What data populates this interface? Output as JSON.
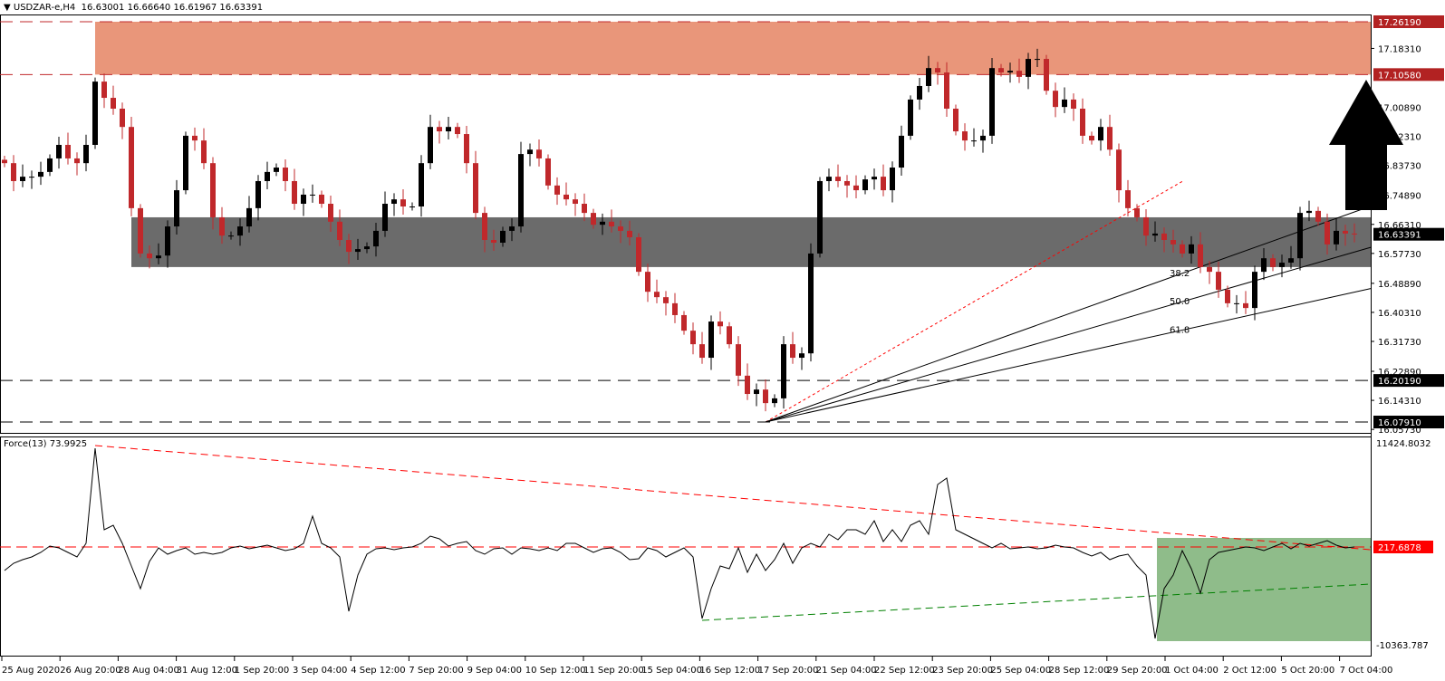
{
  "header": {
    "symbol": "USDZAR-e,H4",
    "open": "16.63001",
    "high": "16.66640",
    "low": "16.61967",
    "close": "16.63391"
  },
  "indicator": {
    "title": "Force(13) 73.9925",
    "level_label": "217.6878",
    "axis_top": "11424.8032",
    "axis_bottom": "-10363.787"
  },
  "colors": {
    "bull": "#000000",
    "bear": "#c0282b",
    "resistance_zone": "#e9967a",
    "support_zone": "#6b6b6b",
    "green_zone": "#8fbc8a",
    "red_line": "#ff0000",
    "green_line": "#008000"
  },
  "chart_data": [
    {
      "type": "candlestick",
      "title": "USDZAR-e,H4",
      "ylim": [
        16.0573,
        17.2619
      ],
      "price_axis_ticks": [
        "17.18310",
        "17.00890",
        "16.92310",
        "16.83730",
        "16.74890",
        "16.66310",
        "16.57730",
        "16.48890",
        "16.40310",
        "16.31730",
        "16.22890",
        "16.14310",
        "16.05730"
      ],
      "price_levels": [
        {
          "label": "17.26190",
          "value": 17.2619,
          "style": "red"
        },
        {
          "label": "17.10580",
          "value": 17.1058,
          "style": "red"
        },
        {
          "label": "16.20190",
          "value": 16.2019,
          "style": "black"
        },
        {
          "label": "16.07910",
          "value": 16.0791,
          "style": "black"
        }
      ],
      "current_price": {
        "label": "16.63391",
        "value": 16.63391
      },
      "resistance_zone": [
        17.1058,
        17.2619
      ],
      "support_zone": [
        16.537,
        16.684
      ],
      "fib_fan": {
        "start_index": 84,
        "start_price": 16.0791,
        "end_index": 130,
        "end_price": 16.79,
        "levels": [
          "38.2",
          "50.0",
          "61.8"
        ]
      },
      "x_labels": [
        "25 Aug 2020",
        "26 Aug 20:00",
        "28 Aug 04:00",
        "31 Aug 12:00",
        "1 Sep 20:00",
        "3 Sep 04:00",
        "4 Sep 12:00",
        "7 Sep 20:00",
        "9 Sep 04:00",
        "10 Sep 12:00",
        "11 Sep 20:00",
        "15 Sep 04:00",
        "16 Sep 12:00",
        "17 Sep 20:00",
        "21 Sep 04:00",
        "22 Sep 12:00",
        "23 Sep 20:00",
        "25 Sep 04:00",
        "28 Sep 12:00",
        "29 Sep 20:00",
        "1 Oct 04:00",
        "2 Oct 12:00",
        "5 Oct 20:00",
        "7 Oct 04:00"
      ],
      "closes": [
        16.844,
        16.791,
        16.804,
        16.804,
        16.818,
        16.858,
        16.898,
        16.858,
        16.844,
        16.898,
        17.085,
        17.037,
        17.005,
        16.951,
        16.711,
        16.577,
        16.563,
        16.571,
        16.657,
        16.764,
        16.925,
        16.911,
        16.844,
        16.684,
        16.63,
        16.63,
        16.657,
        16.711,
        16.791,
        16.818,
        16.831,
        16.791,
        16.724,
        16.751,
        16.751,
        16.724,
        16.671,
        16.617,
        16.582,
        16.59,
        16.598,
        16.644,
        16.724,
        16.737,
        16.716,
        16.716,
        16.844,
        16.951,
        16.938,
        16.951,
        16.93,
        16.844,
        16.697,
        16.617,
        16.609,
        16.644,
        16.657,
        16.871,
        16.884,
        16.858,
        16.778,
        16.751,
        16.737,
        16.724,
        16.697,
        16.662,
        16.671,
        16.657,
        16.644,
        16.625,
        16.523,
        16.464,
        16.448,
        16.43,
        16.395,
        16.349,
        16.309,
        16.269,
        16.376,
        16.362,
        16.309,
        16.216,
        16.162,
        16.175,
        16.135,
        16.149,
        16.309,
        16.269,
        16.282,
        16.577,
        16.791,
        16.804,
        16.791,
        16.778,
        16.764,
        16.796,
        16.804,
        16.764,
        16.831,
        16.925,
        17.032,
        17.072,
        17.125,
        17.112,
        17.005,
        16.938,
        16.911,
        16.911,
        16.925,
        17.125,
        17.112,
        17.117,
        17.099,
        17.152,
        17.152,
        17.058,
        17.01,
        17.032,
        17.005,
        16.925,
        16.911,
        16.951,
        16.884,
        16.764,
        16.711,
        16.684,
        16.63,
        16.636,
        16.617,
        16.604,
        16.577,
        16.604,
        16.537,
        16.523,
        16.47,
        16.43,
        16.43,
        16.416,
        16.523,
        16.563,
        16.537,
        16.55,
        16.563,
        16.697,
        16.703,
        16.671,
        16.604,
        16.644,
        16.636,
        16.634
      ]
    },
    {
      "type": "line",
      "title": "Force(13) 73.9925",
      "ylim": [
        -10363.787,
        11424.8032
      ],
      "level": 217.6878,
      "values": [
        -2200,
        -1456,
        -1084,
        -805,
        -340,
        311,
        125,
        -340,
        -805,
        590,
        10355,
        1985,
        2450,
        590,
        -1735,
        -4060,
        -1270,
        125,
        -526,
        -154,
        125,
        -526,
        -340,
        -526,
        -340,
        125,
        311,
        32,
        218,
        404,
        125,
        -154,
        32,
        590,
        3380,
        590,
        125,
        -805,
        -6385,
        -2665,
        -526,
        32,
        125,
        -61,
        125,
        218,
        590,
        1334,
        1055,
        311,
        590,
        776,
        -154,
        -526,
        32,
        125,
        -526,
        125,
        32,
        -154,
        125,
        -154,
        590,
        590,
        125,
        -340,
        32,
        125,
        -340,
        -1084,
        -991,
        125,
        -154,
        -805,
        -340,
        125,
        -805,
        -7129,
        -4060,
        -1735,
        -2014,
        125,
        -2386,
        -526,
        -2200,
        -1084,
        590,
        -1456,
        125,
        590,
        218,
        1520,
        962,
        1985,
        1985,
        1520,
        2915,
        776,
        1985,
        776,
        2450,
        2915,
        1520,
        6635,
        7286,
        1985,
        1520,
        1055,
        590,
        125,
        590,
        32,
        125,
        218,
        32,
        125,
        404,
        218,
        125,
        -340,
        -712,
        -340,
        -1084,
        -712,
        -526,
        -1735,
        -2665,
        -9175,
        -4060,
        -2665,
        -154,
        -2014,
        -4525,
        -1084,
        -340,
        -154,
        32,
        218,
        125,
        -154,
        218,
        590,
        32,
        590,
        311,
        590,
        869,
        404,
        125,
        218
      ]
    }
  ]
}
